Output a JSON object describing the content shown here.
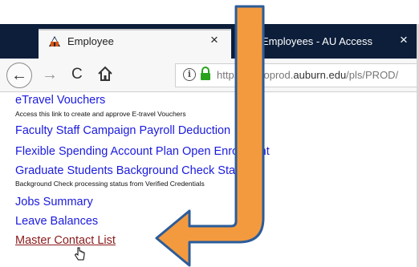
{
  "browser": {
    "active_tab": {
      "title": "Employee",
      "favicon": "auburn-logo-icon",
      "close": "×"
    },
    "inactive_tab": {
      "title": "Employees - AU Access",
      "close": "×"
    },
    "nav": {
      "back": "←",
      "forward": "→",
      "reload": "C",
      "home": "home-icon"
    },
    "url": {
      "prefix": "http",
      "hidden": "s://sssoprod.",
      "domain": "auburn.edu",
      "path": "/pls/PROD/"
    }
  },
  "links": [
    {
      "label": "eTravel Vouchers",
      "description": "Access this link to create and approve E-travel Vouchers"
    },
    {
      "label": "Faculty Staff Campaign Payroll Deduction"
    },
    {
      "label": "Flexible Spending Account Plan Open Enrollment"
    },
    {
      "label": "Graduate Students Background Check Status",
      "description": "Background Check processing status from Verified Credentials"
    },
    {
      "label": "Jobs Summary"
    },
    {
      "label": "Leave Balances"
    },
    {
      "label": "Master Contact List"
    }
  ],
  "annotation": {
    "arrow_color": "#f39a3f",
    "arrow_outline": "#2b5c9a"
  }
}
